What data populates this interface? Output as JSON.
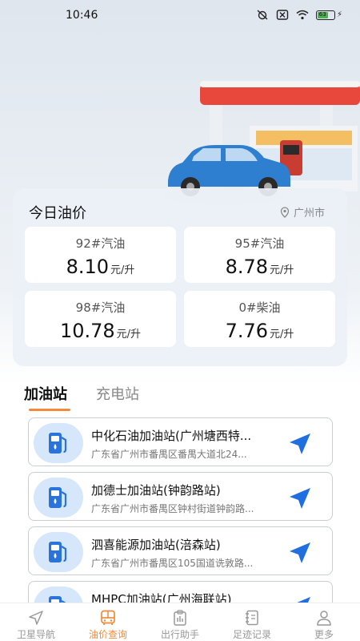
{
  "status_bar": {
    "time": "10:46",
    "battery": "63"
  },
  "price_card": {
    "title": "今日油价",
    "location": "广州市",
    "prices": [
      {
        "name": "92#汽油",
        "price": "8.10",
        "unit": "元/升"
      },
      {
        "name": "95#汽油",
        "price": "8.78",
        "unit": "元/升"
      },
      {
        "name": "98#汽油",
        "price": "10.78",
        "unit": "元/升"
      },
      {
        "name": "0#柴油",
        "price": "7.76",
        "unit": "元/升"
      }
    ]
  },
  "tabs": {
    "active": "加油站",
    "inactive": "充电站"
  },
  "stations": [
    {
      "name": "中化石油加油站(广州塘西特...",
      "address": "广东省广州市番禺区番禺大道北24..."
    },
    {
      "name": "加德士加油站(钟韵路站)",
      "address": "广东省广州市番禺区钟村街道钟韵路..."
    },
    {
      "name": "泗喜能源加油站(涪森站)",
      "address": "广东省广州市番禺区105国道诜敦路..."
    },
    {
      "name": "MHPC加油站(广州海联站)",
      "address": ""
    }
  ],
  "bottom_nav": [
    {
      "label": "卫星导航",
      "icon": "navigation-arrow-icon"
    },
    {
      "label": "油价查询",
      "icon": "bus-icon"
    },
    {
      "label": "出行助手",
      "icon": "clipboard-icon"
    },
    {
      "label": "足迹记录",
      "icon": "notebook-icon"
    },
    {
      "label": "更多",
      "icon": "person-icon"
    }
  ],
  "colors": {
    "accent": "#f28a3a",
    "nav_arrow": "#1f6fe0",
    "icon_bg": "#d6e7fb"
  }
}
